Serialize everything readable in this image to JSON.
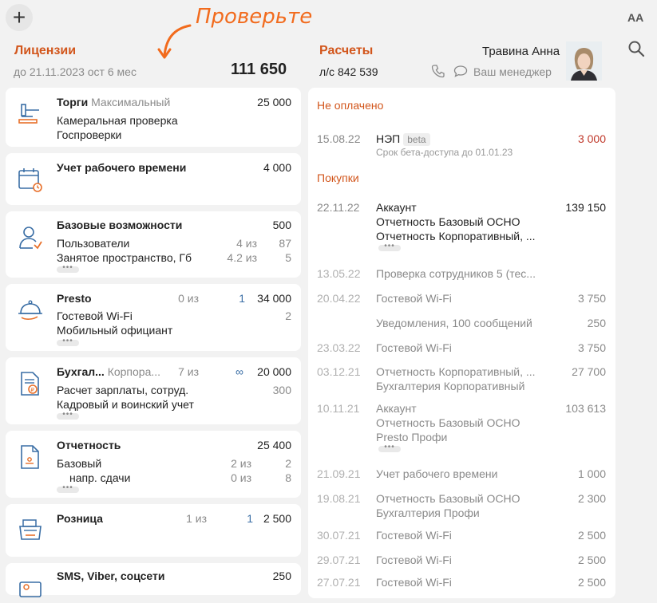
{
  "header": {
    "add_label": "+",
    "annotation": "Проверьте",
    "font_toggle": "AA",
    "manager_name": "Травина Анна",
    "manager_link": "Ваш менеджер"
  },
  "licenses": {
    "title": "Лицензии",
    "period": "до 21.11.2023 ост 6 мес",
    "total": "111 650",
    "cards": [
      {
        "title": "Торги",
        "subtitle": "Максимальный",
        "price": "25 000",
        "lines": [
          "Камеральная проверка",
          "Госпроверки"
        ]
      },
      {
        "title": "Учет рабочего времени",
        "price": "4 000"
      },
      {
        "title": "Базовые возможности",
        "price": "500",
        "rows": [
          {
            "label": "Пользователи",
            "used": "4 из",
            "total": "87"
          },
          {
            "label": "Занятое пространство, Гб",
            "used": "4.2 из",
            "total": "5"
          }
        ]
      },
      {
        "title": "Presto",
        "used": "0 из",
        "count": "1",
        "price": "34 000",
        "rows": [
          {
            "label": "Гостевой Wi-Fi",
            "total": "2"
          },
          {
            "label": "Мобильный официант"
          }
        ]
      },
      {
        "title": "Бухгал...",
        "subtitle": "Корпора...",
        "used": "7 из",
        "count": "∞",
        "price": "20 000",
        "rows": [
          {
            "label": "Расчет зарплаты, сотруд.",
            "total": "300"
          },
          {
            "label": "Кадровый и воинский учет"
          }
        ]
      },
      {
        "title": "Отчетность",
        "price": "25 400",
        "rows": [
          {
            "label": "Базовый",
            "used": "2 из",
            "total": "2"
          },
          {
            "label": "напр. сдачи",
            "used": "0 из",
            "total": "8"
          }
        ]
      },
      {
        "title": "Розница",
        "used": "1 из",
        "count": "1",
        "price": "2 500"
      },
      {
        "title": "SMS, Viber, соцсети",
        "price": "250"
      }
    ]
  },
  "payments": {
    "title": "Расчеты",
    "account": "л/с 842 539",
    "unpaid_label": "Не оплачено",
    "unpaid": {
      "date": "15.08.22",
      "desc": "НЭП",
      "badge": "beta",
      "note": "Срок бета-доступа до 01.01.23",
      "amount": "3 000"
    },
    "purchases_label": "Покупки",
    "purchases": [
      {
        "date": "22.11.22",
        "lines": [
          "Аккаунт",
          "Отчетность Базовый ОСНО",
          "Отчетность Корпоративный, ..."
        ],
        "amount": "139 150"
      },
      {
        "date": "13.05.22",
        "lines": [
          "Проверка сотрудников 5 (тес..."
        ],
        "amount": ""
      },
      {
        "date": "20.04.22",
        "lines": [
          "Гостевой Wi-Fi"
        ],
        "amount": "3 750"
      },
      {
        "date": "",
        "lines": [
          "Уведомления, 100 сообщений"
        ],
        "amount": "250"
      },
      {
        "date": "23.03.22",
        "lines": [
          "Гостевой Wi-Fi"
        ],
        "amount": "3 750"
      },
      {
        "date": "03.12.21",
        "lines": [
          "Отчетность Корпоративный, ...",
          "Бухгалтерия Корпоративный"
        ],
        "amount": "27 700"
      },
      {
        "date": "10.11.21",
        "lines": [
          "Аккаунт",
          "Отчетность Базовый ОСНО",
          "Presto Профи"
        ],
        "amount": "103 613"
      },
      {
        "date": "21.09.21",
        "lines": [
          "Учет рабочего времени"
        ],
        "amount": "1 000"
      },
      {
        "date": "19.08.21",
        "lines": [
          "Отчетность Базовый ОСНО",
          "Бухгалтерия Профи"
        ],
        "amount": "2 300"
      },
      {
        "date": "30.07.21",
        "lines": [
          "Гостевой Wi-Fi"
        ],
        "amount": "2 500"
      },
      {
        "date": "29.07.21",
        "lines": [
          "Гостевой Wi-Fi"
        ],
        "amount": "2 500"
      },
      {
        "date": "27.07.21",
        "lines": [
          "Гостевой Wi-Fi"
        ],
        "amount": "2 500"
      }
    ]
  },
  "colors": {
    "accent": "#d2561c",
    "annotation": "#f26b1d",
    "debt": "#c0392b"
  },
  "icons": [
    "plus-icon",
    "font-size-icon",
    "search-icon",
    "phone-icon",
    "chat-icon",
    "gavel-icon",
    "calendar-clock-icon",
    "user-settings-icon",
    "cloche-icon",
    "accounting-doc-icon",
    "report-doc-icon",
    "cash-register-icon",
    "message-icon"
  ]
}
